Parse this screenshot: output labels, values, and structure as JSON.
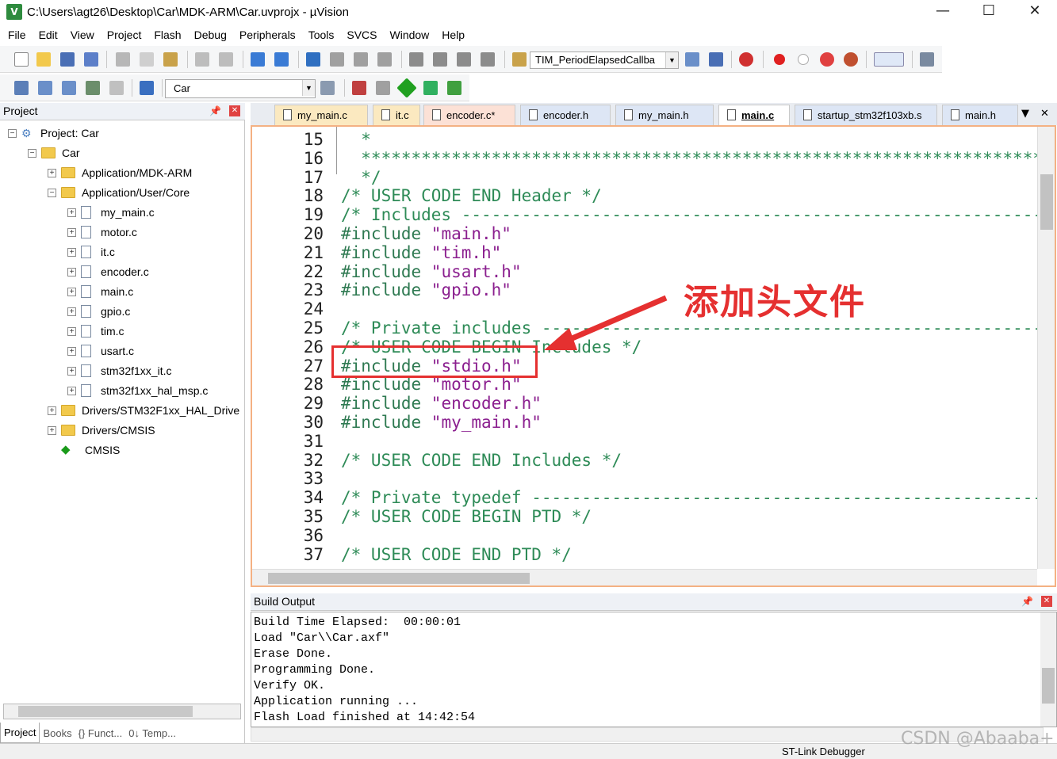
{
  "window": {
    "title": "C:\\Users\\agt26\\Desktop\\Car\\MDK-ARM\\Car.uvprojx - µVision",
    "minimize": "—",
    "maximize": "☐",
    "close": "✕"
  },
  "menu": [
    "File",
    "Edit",
    "View",
    "Project",
    "Flash",
    "Debug",
    "Peripherals",
    "Tools",
    "SVCS",
    "Window",
    "Help"
  ],
  "toolbar": {
    "function_box": "TIM_PeriodElapsedCallba",
    "target_box": "Car"
  },
  "project_panel": {
    "title": "Project",
    "tree": [
      {
        "label": "Project: Car",
        "level": 0,
        "kind": "gear",
        "exp": "⊟"
      },
      {
        "label": "Car",
        "level": 1,
        "kind": "folder",
        "exp": "⊟"
      },
      {
        "label": "Application/MDK-ARM",
        "level": 2,
        "kind": "folder",
        "exp": "⊞"
      },
      {
        "label": "Application/User/Core",
        "level": 2,
        "kind": "folder",
        "exp": "⊟"
      },
      {
        "label": "my_main.c",
        "level": 3,
        "kind": "file",
        "exp": "⊞"
      },
      {
        "label": "motor.c",
        "level": 3,
        "kind": "file",
        "exp": "⊞"
      },
      {
        "label": "it.c",
        "level": 3,
        "kind": "file",
        "exp": "⊞"
      },
      {
        "label": "encoder.c",
        "level": 3,
        "kind": "file",
        "exp": "⊞"
      },
      {
        "label": "main.c",
        "level": 3,
        "kind": "file",
        "exp": "⊞"
      },
      {
        "label": "gpio.c",
        "level": 3,
        "kind": "file",
        "exp": "⊞"
      },
      {
        "label": "tim.c",
        "level": 3,
        "kind": "file",
        "exp": "⊞"
      },
      {
        "label": "usart.c",
        "level": 3,
        "kind": "file",
        "exp": "⊞"
      },
      {
        "label": "stm32f1xx_it.c",
        "level": 3,
        "kind": "file",
        "exp": "⊞"
      },
      {
        "label": "stm32f1xx_hal_msp.c",
        "level": 3,
        "kind": "file",
        "exp": "⊞"
      },
      {
        "label": "Drivers/STM32F1xx_HAL_Drive",
        "level": 2,
        "kind": "folder",
        "exp": "⊞"
      },
      {
        "label": "Drivers/CMSIS",
        "level": 2,
        "kind": "folder",
        "exp": "⊞"
      },
      {
        "label": "CMSIS",
        "level": 2,
        "kind": "cmsis",
        "exp": ""
      }
    ],
    "bottom_tabs": [
      "Project",
      "Books",
      "{} Funct...",
      "0↓ Temp..."
    ]
  },
  "editor": {
    "tabs": [
      {
        "label": "my_main.c",
        "style": "c1"
      },
      {
        "label": "it.c",
        "style": "c1"
      },
      {
        "label": "encoder.c*",
        "style": "c2"
      },
      {
        "label": "encoder.h",
        "style": "c3"
      },
      {
        "label": "my_main.h",
        "style": "c3"
      },
      {
        "label": "main.c",
        "style": "active"
      },
      {
        "label": "startup_stm32f103xb.s",
        "style": "c3"
      },
      {
        "label": "main.h",
        "style": "c3"
      }
    ],
    "lines": [
      {
        "n": "15",
        "segs": [
          {
            "t": "  *",
            "c": "cmt"
          }
        ]
      },
      {
        "n": "16",
        "segs": [
          {
            "t": "  ***************************************************************************",
            "c": "cmt"
          }
        ]
      },
      {
        "n": "17",
        "segs": [
          {
            "t": "  */",
            "c": "cmt"
          }
        ]
      },
      {
        "n": "18",
        "segs": [
          {
            "t": "/* USER CODE END Header */",
            "c": "cmt"
          }
        ]
      },
      {
        "n": "19",
        "segs": [
          {
            "t": "/* Includes ------------------------------------------------------------------",
            "c": "cmt"
          }
        ]
      },
      {
        "n": "20",
        "segs": [
          {
            "t": "#include ",
            "c": "pp"
          },
          {
            "t": "\"main.h\"",
            "c": "str"
          }
        ]
      },
      {
        "n": "21",
        "segs": [
          {
            "t": "#include ",
            "c": "pp"
          },
          {
            "t": "\"tim.h\"",
            "c": "str"
          }
        ]
      },
      {
        "n": "22",
        "segs": [
          {
            "t": "#include ",
            "c": "pp"
          },
          {
            "t": "\"usart.h\"",
            "c": "str"
          }
        ]
      },
      {
        "n": "23",
        "segs": [
          {
            "t": "#include ",
            "c": "pp"
          },
          {
            "t": "\"gpio.h\"",
            "c": "str"
          }
        ]
      },
      {
        "n": "24",
        "segs": []
      },
      {
        "n": "25",
        "segs": [
          {
            "t": "/* Private includes ----------------------------------------------------------",
            "c": "cmt"
          }
        ]
      },
      {
        "n": "26",
        "segs": [
          {
            "t": "/* USER CODE BEGIN Includes */",
            "c": "cmt"
          }
        ]
      },
      {
        "n": "27",
        "segs": [
          {
            "t": "#include ",
            "c": "pp"
          },
          {
            "t": "\"stdio.h\"",
            "c": "str"
          }
        ]
      },
      {
        "n": "28",
        "segs": [
          {
            "t": "#include ",
            "c": "pp"
          },
          {
            "t": "\"motor.h\"",
            "c": "str"
          }
        ]
      },
      {
        "n": "29",
        "segs": [
          {
            "t": "#include ",
            "c": "pp"
          },
          {
            "t": "\"encoder.h\"",
            "c": "str"
          }
        ]
      },
      {
        "n": "30",
        "segs": [
          {
            "t": "#include ",
            "c": "pp"
          },
          {
            "t": "\"my_main.h\"",
            "c": "str"
          }
        ]
      },
      {
        "n": "31",
        "segs": []
      },
      {
        "n": "32",
        "segs": [
          {
            "t": "/* USER CODE END Includes */",
            "c": "cmt"
          }
        ]
      },
      {
        "n": "33",
        "segs": []
      },
      {
        "n": "34",
        "segs": [
          {
            "t": "/* Private typedef -----------------------------------------------------------",
            "c": "cmt"
          }
        ]
      },
      {
        "n": "35",
        "segs": [
          {
            "t": "/* USER CODE BEGIN PTD */",
            "c": "cmt"
          }
        ]
      },
      {
        "n": "36",
        "segs": []
      },
      {
        "n": "37",
        "segs": [
          {
            "t": "/* USER CODE END PTD */",
            "c": "cmt"
          }
        ]
      }
    ]
  },
  "annotation": {
    "text": "添加头文件",
    "color": "#e53030"
  },
  "build_output": {
    "title": "Build Output",
    "lines": [
      "Build Time Elapsed:  00:00:01",
      "Load \"Car\\\\Car.axf\"",
      "Erase Done.",
      "Programming Done.",
      "Verify OK.",
      "Application running ...",
      "Flash Load finished at 14:42:54"
    ]
  },
  "status_bar": {
    "debugger": "ST-Link Debugger"
  },
  "watermark": "CSDN @Abaaba+"
}
